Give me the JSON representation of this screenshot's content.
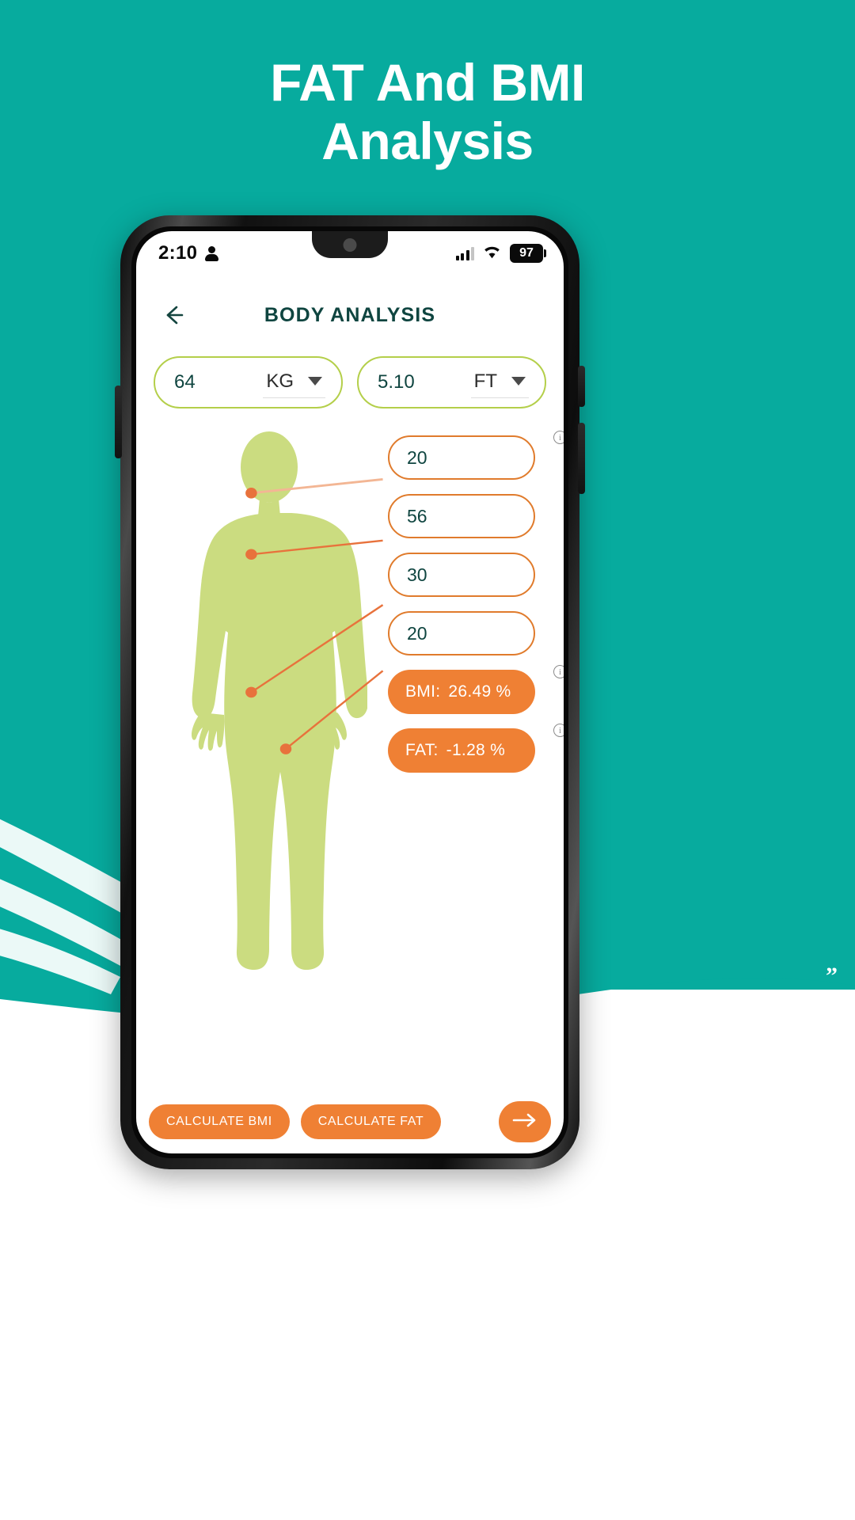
{
  "promo": {
    "heading_line1": "FAT And BMI",
    "heading_line2": "Analysis",
    "background_color": "#07ab9e",
    "heading_color": "#ffffff"
  },
  "status_bar": {
    "time": "2:10",
    "person_icon": "person-icon",
    "signal_icon": "signal-bars-icon",
    "wifi_icon": "wifi-icon",
    "battery_level": "97"
  },
  "app_bar": {
    "back_icon": "back-arrow-icon",
    "title": "BODY ANALYSIS",
    "title_color": "#0f4540"
  },
  "unit_inputs": [
    {
      "name": "weight",
      "value": "64",
      "unit_label": "KG",
      "placeholder": "Weight",
      "caret_icon": "chevron-down-icon"
    },
    {
      "name": "height",
      "value": "5.10",
      "unit_label": "FT",
      "placeholder": "Height",
      "caret_icon": "chevron-down-icon"
    }
  ],
  "measurements": [
    {
      "id": "neck",
      "value": "20",
      "has_info": true,
      "type": "input"
    },
    {
      "id": "chest",
      "value": "56",
      "has_info": false,
      "type": "input"
    },
    {
      "id": "waist",
      "value": "30",
      "has_info": false,
      "type": "input"
    },
    {
      "id": "hip",
      "value": "20",
      "has_info": false,
      "type": "input"
    }
  ],
  "results": [
    {
      "id": "bmi",
      "label": "BMI:",
      "value": "26.49 %",
      "has_info": true,
      "color": "#ef8034"
    },
    {
      "id": "fat",
      "label": "FAT:",
      "value": "-1.28 %",
      "has_info": true,
      "color": "#ef8034"
    }
  ],
  "bottom_bar": {
    "calculate_bmi_label": "CALCULATE BMI",
    "calculate_fat_label": "CALCULATE FAT",
    "next_icon": "arrow-right-icon"
  },
  "theme": {
    "field_border": "#b4cf4a",
    "accent_orange": "#ef8034",
    "body_fill": "#cbdc80",
    "deco_quote": "”"
  }
}
